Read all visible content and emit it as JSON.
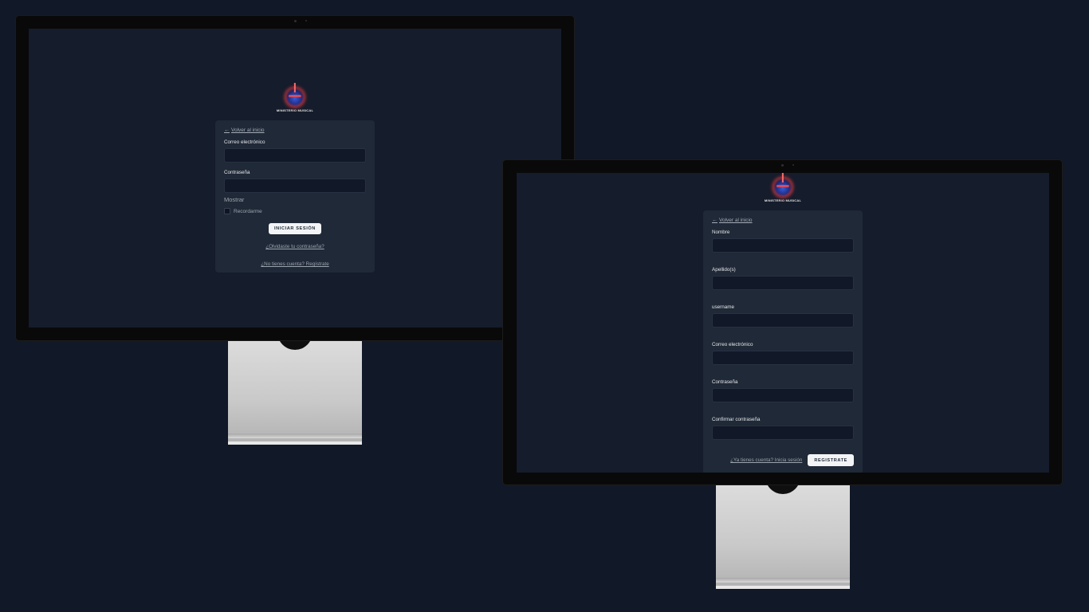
{
  "colors": {
    "page_bg": "#111827",
    "screen_bg": "#151c2c",
    "card_bg": "#1f2937",
    "input_bg": "#111827",
    "button_bg": "#f3f4f6",
    "link_text": "#9ca3af"
  },
  "logo": {
    "icon": "guitar-logo-icon",
    "text": "MINISTERIO MUSICAL"
  },
  "login": {
    "back_link": "Volver al inicio",
    "email_label": "Correo electrónico",
    "email_value": "",
    "password_label": "Contraseña",
    "password_value": "",
    "show_password": "Mostrar",
    "remember_label": "Recordarme",
    "remember_checked": false,
    "submit_label": "INICIAR SESIÓN",
    "forgot_link": "¿Olvidaste tu contraseña?",
    "register_link": "¿No tienes cuenta? Regístrate"
  },
  "register": {
    "back_link": "Volver al inicio",
    "fields": [
      {
        "label": "Nombre",
        "value": ""
      },
      {
        "label": "Apellido(s)",
        "value": ""
      },
      {
        "label": "username",
        "value": ""
      },
      {
        "label": "Correo electrónico",
        "value": ""
      },
      {
        "label": "Contraseña",
        "value": ""
      },
      {
        "label": "Confirmar contraseña",
        "value": ""
      }
    ],
    "login_link": "¿Ya tienes cuenta? Inicia sesión",
    "submit_label": "REGISTRATE"
  }
}
